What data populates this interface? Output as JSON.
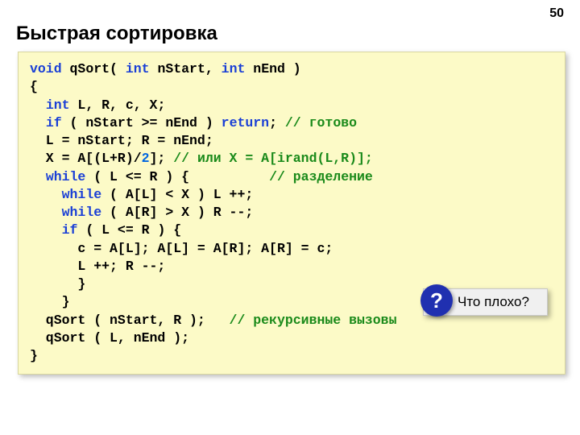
{
  "pageNumber": "50",
  "title": "Быстрая сортировка",
  "code": {
    "l1_void": "void",
    "l1_rest": " qSort( ",
    "l1_int1": "int",
    "l1_mid": " nStart, ",
    "l1_int2": "int",
    "l1_end": " nEnd )",
    "l2": "{",
    "l3_int": "int",
    "l3_rest": " L, R, c, X;",
    "l4_if": "if",
    "l4_mid": " ( nStart >= nEnd ) ",
    "l4_ret": "return",
    "l4_semi": "; ",
    "l4_comment": "// готово",
    "l5": "  L = nStart; R = nEnd;",
    "l6_a": "  X = A[(L+R)/",
    "l6_num": "2",
    "l6_b": "]; ",
    "l6_comment": "// или X = A[irand(L,R)];",
    "l7_while": "while",
    "l7_cond": " ( L <= R ) {          ",
    "l7_comment": "// разделение",
    "l8_while": "while",
    "l8_rest": " ( A[L] < X ) L ++;",
    "l9_while": "while",
    "l9_rest": " ( A[R] > X ) R --;",
    "l10_if": "if",
    "l10_rest": " ( L <= R ) {",
    "l11": "      c = A[L]; A[L] = A[R]; A[R] = c;",
    "l12": "      L ++; R --;",
    "l13": "      }",
    "l14": "    }",
    "l15_a": "  qSort ( nStart, R );   ",
    "l15_comment": "// рекурсивные вызовы",
    "l16": "  qSort ( L, nEnd );",
    "l17": "}"
  },
  "callout": {
    "badge": "?",
    "text": "Что плохо?"
  }
}
